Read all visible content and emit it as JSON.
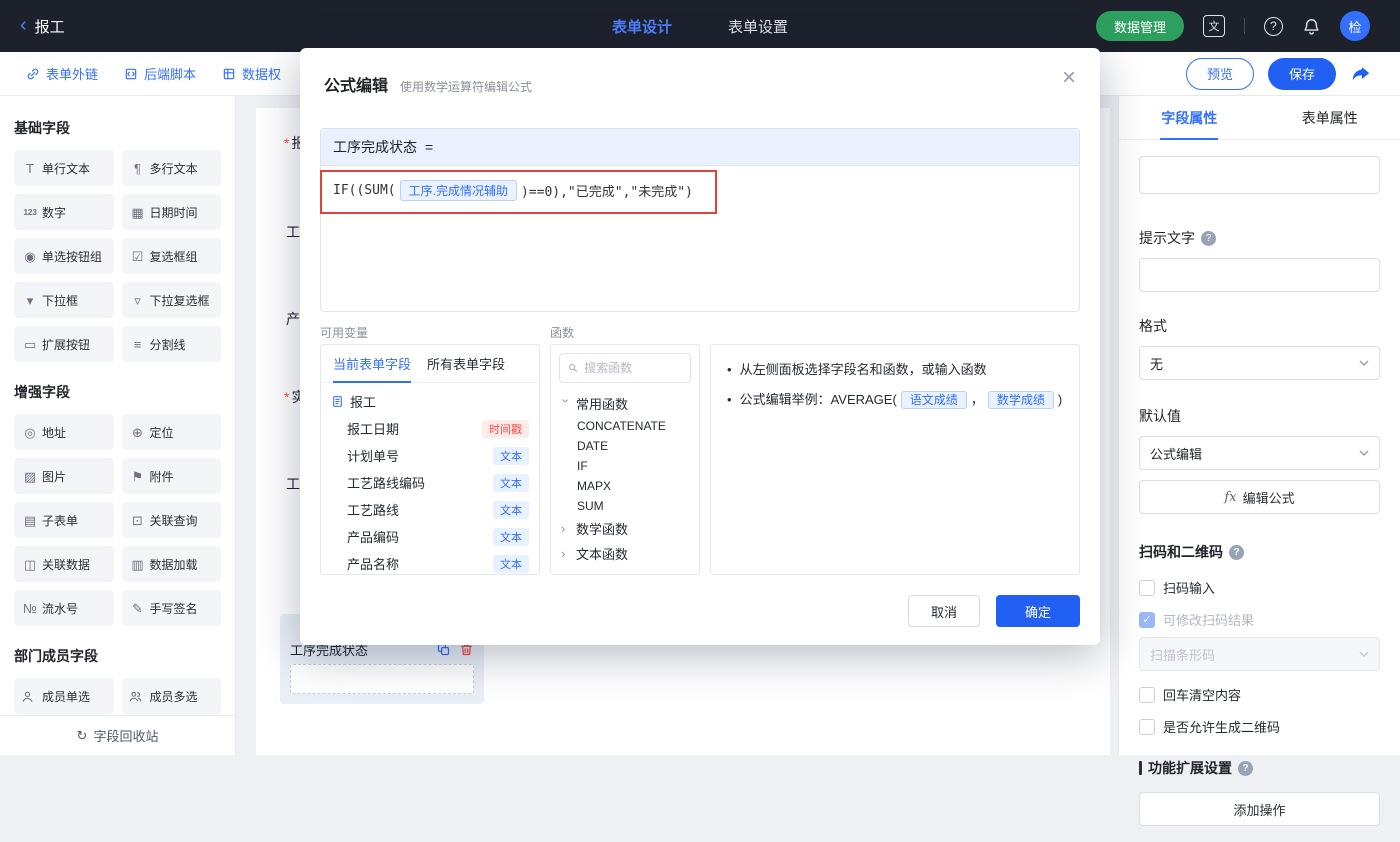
{
  "colors": {
    "accent": "#3370ff",
    "primary_button": "#2160f3",
    "topbar_bg": "#1d212b",
    "green_button": "#2da05f",
    "danger": "#f54a45",
    "annotation_red": "#e5413b",
    "badge_red_bg": "#ffece8",
    "badge_blue_bg": "#e8f1fe"
  },
  "icons": {
    "back": "‹",
    "translate": "文",
    "help": "?",
    "close": "×",
    "check": "✓",
    "chevron": "›",
    "bullet": "•",
    "recycle": "↻",
    "fx": "fx"
  },
  "topbar": {
    "back_label": "报工",
    "tabs": [
      {
        "label": "表单设计"
      },
      {
        "label": "表单设置"
      }
    ],
    "data_manage_label": "数据管理",
    "avatar_text": "检"
  },
  "toolbar": {
    "links": [
      {
        "label": "表单外链"
      },
      {
        "label": "后端脚本"
      },
      {
        "label": "数据权"
      }
    ],
    "preview_label": "预览",
    "save_label": "保存"
  },
  "sidebar": {
    "sections": [
      {
        "title": "基础字段",
        "items": [
          {
            "icon": "T",
            "label": "单行文本"
          },
          {
            "icon": "¶",
            "label": "多行文本"
          },
          {
            "icon": "123",
            "label": "数字"
          },
          {
            "icon": "▦",
            "label": "日期时间"
          },
          {
            "icon": "◉",
            "label": "单选按钮组"
          },
          {
            "icon": "☑",
            "label": "复选框组"
          },
          {
            "icon": "▾",
            "label": "下拉框"
          },
          {
            "icon": "▿",
            "label": "下拉复选框"
          },
          {
            "icon": "▭",
            "label": "扩展按钮"
          },
          {
            "icon": "≡",
            "label": "分割线"
          }
        ]
      },
      {
        "title": "增强字段",
        "items": [
          {
            "icon": "◎",
            "label": "地址"
          },
          {
            "icon": "⊕",
            "label": "定位"
          },
          {
            "icon": "▨",
            "label": "图片"
          },
          {
            "icon": "⚑",
            "label": "附件"
          },
          {
            "icon": "▤",
            "label": "子表单"
          },
          {
            "icon": "⊡",
            "label": "关联查询"
          },
          {
            "icon": "◫",
            "label": "关联数据"
          },
          {
            "icon": "▥",
            "label": "数据加载"
          },
          {
            "icon": "№",
            "label": "流水号"
          },
          {
            "icon": "✎",
            "label": "手写签名"
          }
        ]
      },
      {
        "title": "部门成员字段",
        "items": [
          {
            "icon": "",
            "label": "成员单选"
          },
          {
            "icon": "",
            "label": "成员多选"
          }
        ]
      }
    ],
    "recycle_label": "字段回收站"
  },
  "canvas": {
    "fragments": [
      {
        "star": "*",
        "text": "报"
      },
      {
        "star": "",
        "text": "工"
      },
      {
        "star": "",
        "text": "产"
      },
      {
        "star": "*",
        "text": "实"
      },
      {
        "star": "",
        "text": "工"
      }
    ],
    "selected_field": {
      "label": "工序完成状态"
    }
  },
  "modal": {
    "title": "公式编辑",
    "subtitle": "使用数学运算符编辑公式",
    "field_name": "工序完成状态",
    "eq": "=",
    "formula": {
      "prefix": "IF((SUM(",
      "chip": "工序.完成情况辅助",
      "suffix": ")==0),\"已完成\",\"未完成\")"
    },
    "variables": {
      "label": "可用变量",
      "tabs": [
        {
          "label": "当前表单字段"
        },
        {
          "label": "所有表单字段"
        }
      ],
      "root": "报工",
      "items": [
        {
          "name": "报工日期",
          "badge": "时间戳",
          "badge_type": "red"
        },
        {
          "name": "计划单号",
          "badge": "文本",
          "badge_type": "blue"
        },
        {
          "name": "工艺路线编码",
          "badge": "文本",
          "badge_type": "blue"
        },
        {
          "name": "工艺路线",
          "badge": "文本",
          "badge_type": "blue"
        },
        {
          "name": "产品编码",
          "badge": "文本",
          "badge_type": "blue"
        },
        {
          "name": "产品名称",
          "badge": "文本",
          "badge_type": "blue"
        }
      ]
    },
    "functions": {
      "label": "函数",
      "search_placeholder": "搜索函数",
      "groups": [
        {
          "name": "常用函数",
          "expanded": true,
          "items": [
            "CONCATENATE",
            "DATE",
            "IF",
            "MAPX",
            "SUM"
          ]
        },
        {
          "name": "数学函数",
          "expanded": false,
          "items": []
        },
        {
          "name": "文本函数",
          "expanded": false,
          "items": []
        }
      ]
    },
    "help": {
      "line1": "从左侧面板选择字段名和函数，或输入函数",
      "line2_prefix": "公式编辑举例：AVERAGE(",
      "chip1": "语文成绩",
      "separator": "，",
      "chip2": "数学成绩",
      "line2_suffix": ")"
    },
    "cancel_label": "取消",
    "ok_label": "确定"
  },
  "properties": {
    "tabs": [
      {
        "label": "字段属性"
      },
      {
        "label": "表单属性"
      }
    ],
    "hint_label": "提示文字",
    "format_label": "格式",
    "format_value": "无",
    "default_label": "默认值",
    "default_value": "公式编辑",
    "formula_button_label": "编辑公式",
    "scan_section_label": "扫码和二维码",
    "checkbox_scan_input": "扫码输入",
    "checkbox_modify_result": "可修改扫码结果",
    "barcode_select_value": "扫描条形码",
    "checkbox_enter_clear": "回车清空内容",
    "checkbox_allow_qr": "是否允许生成二维码",
    "extension_section_label": "功能扩展设置",
    "add_operation_label": "添加操作"
  }
}
